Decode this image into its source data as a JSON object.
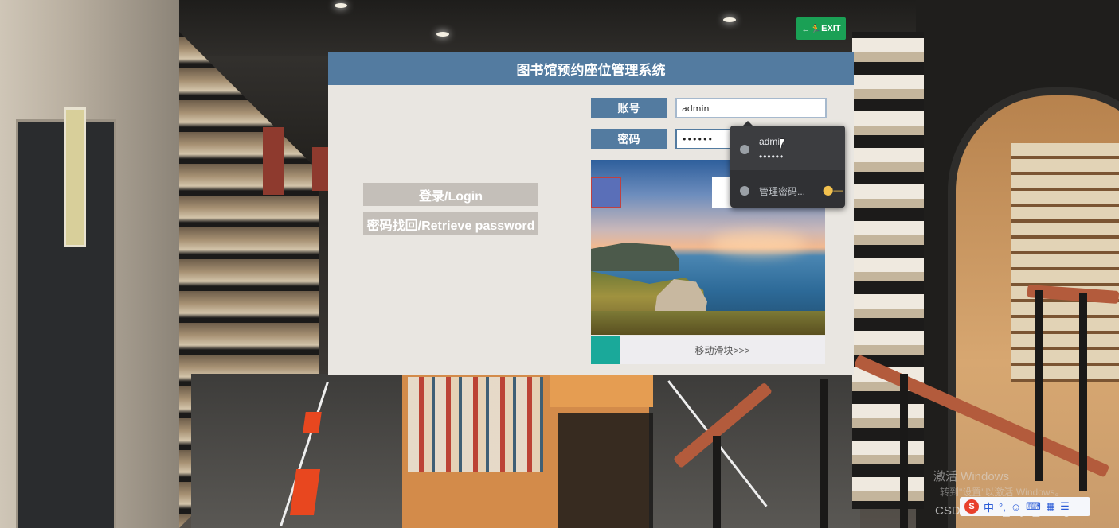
{
  "panel": {
    "title": "图书馆预约座位管理系统",
    "login_button": "登录/Login",
    "retrieve_button": "密码找回/Retrieve password",
    "account_label": "账号",
    "account_value": "admin",
    "password_label": "密码",
    "password_value": "••••••"
  },
  "captcha": {
    "slider_hint": "移动滑块>>>",
    "handle_position_fraction": 0
  },
  "autofill": {
    "username": "admin",
    "password_mask": "••••••",
    "manage_label": "管理密码..."
  },
  "background": {
    "exit_sign": "EXIT"
  },
  "overlays": {
    "activate_windows": "激活 Windows",
    "activate_hint": "转到\"设置\"以激活 Windows。",
    "csdn_credit": "CSDN @vx2_Biye_Design",
    "ime_items": [
      "S",
      "中",
      "°,",
      "☺",
      "⌨",
      "▦",
      "☰"
    ]
  },
  "colors": {
    "header": "#537ba0",
    "slider_handle": "#1aa99a",
    "panel_bg": "#e9e6e1"
  }
}
